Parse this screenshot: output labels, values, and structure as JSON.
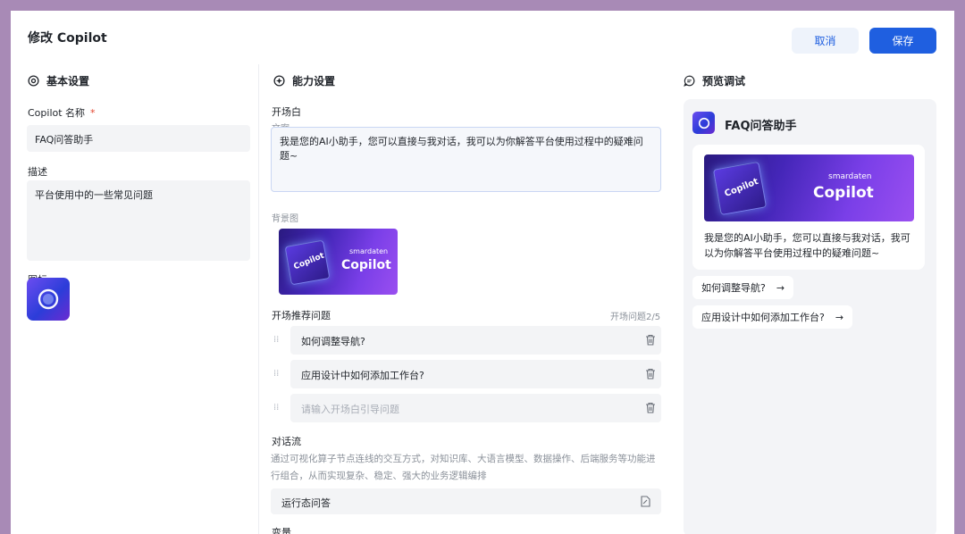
{
  "header": {
    "title": "修改 Copilot",
    "cancel_label": "取消",
    "save_label": "保存"
  },
  "basic": {
    "section_title": "基本设置",
    "name_label": "Copilot 名称",
    "required_mark": "*",
    "name_value": "FAQ问答助手",
    "desc_label": "描述",
    "desc_value": "平台使用中的一些常见问题",
    "icon_label": "图标"
  },
  "ability": {
    "section_title": "能力设置",
    "opening_label": "开场白",
    "copy_label": "文案",
    "opening_text": "我是您的AI小助手，您可以直接与我对话，我可以为你解答平台使用过程中的疑难问题~",
    "bg_label": "背景图",
    "banner_brand": "smardaten",
    "banner_title": "Copilot",
    "questions_label": "开场推荐问题",
    "questions_count": "开场问题2/5",
    "questions": [
      {
        "text": "如何调整导航?",
        "placeholder": false
      },
      {
        "text": "应用设计中如何添加工作台?",
        "placeholder": false
      },
      {
        "text": "请输入开场白引导问题",
        "placeholder": true
      }
    ],
    "flow_label": "对话流",
    "flow_desc": "通过可视化算子节点连线的交互方式，对知识库、大语言模型、数据操作、后端服务等功能进行组合，从而实现复杂、稳定、强大的业务逻辑编排",
    "flow_value": "运行态问答",
    "vars_label": "变量"
  },
  "preview": {
    "section_title": "预览调试",
    "bot_name": "FAQ问答助手",
    "banner_brand": "smardaten",
    "banner_title": "Copilot",
    "message": "我是您的AI小助手，您可以直接与我对话，我可以为你解答平台使用过程中的疑难问题~",
    "chips": [
      "如何调整导航?",
      "应用设计中如何添加工作台?"
    ],
    "chip_arrow": "→"
  },
  "icons": {
    "basic": "settings-circle-icon",
    "ability": "ability-icon",
    "preview": "chat-bubble-icon",
    "drag": "drag-handle-icon",
    "delete": "trash-icon",
    "edit": "edit-document-icon"
  },
  "colors": {
    "primary": "#1f5fe0",
    "required": "#e3442d",
    "field_bg": "#f3f4f6"
  }
}
